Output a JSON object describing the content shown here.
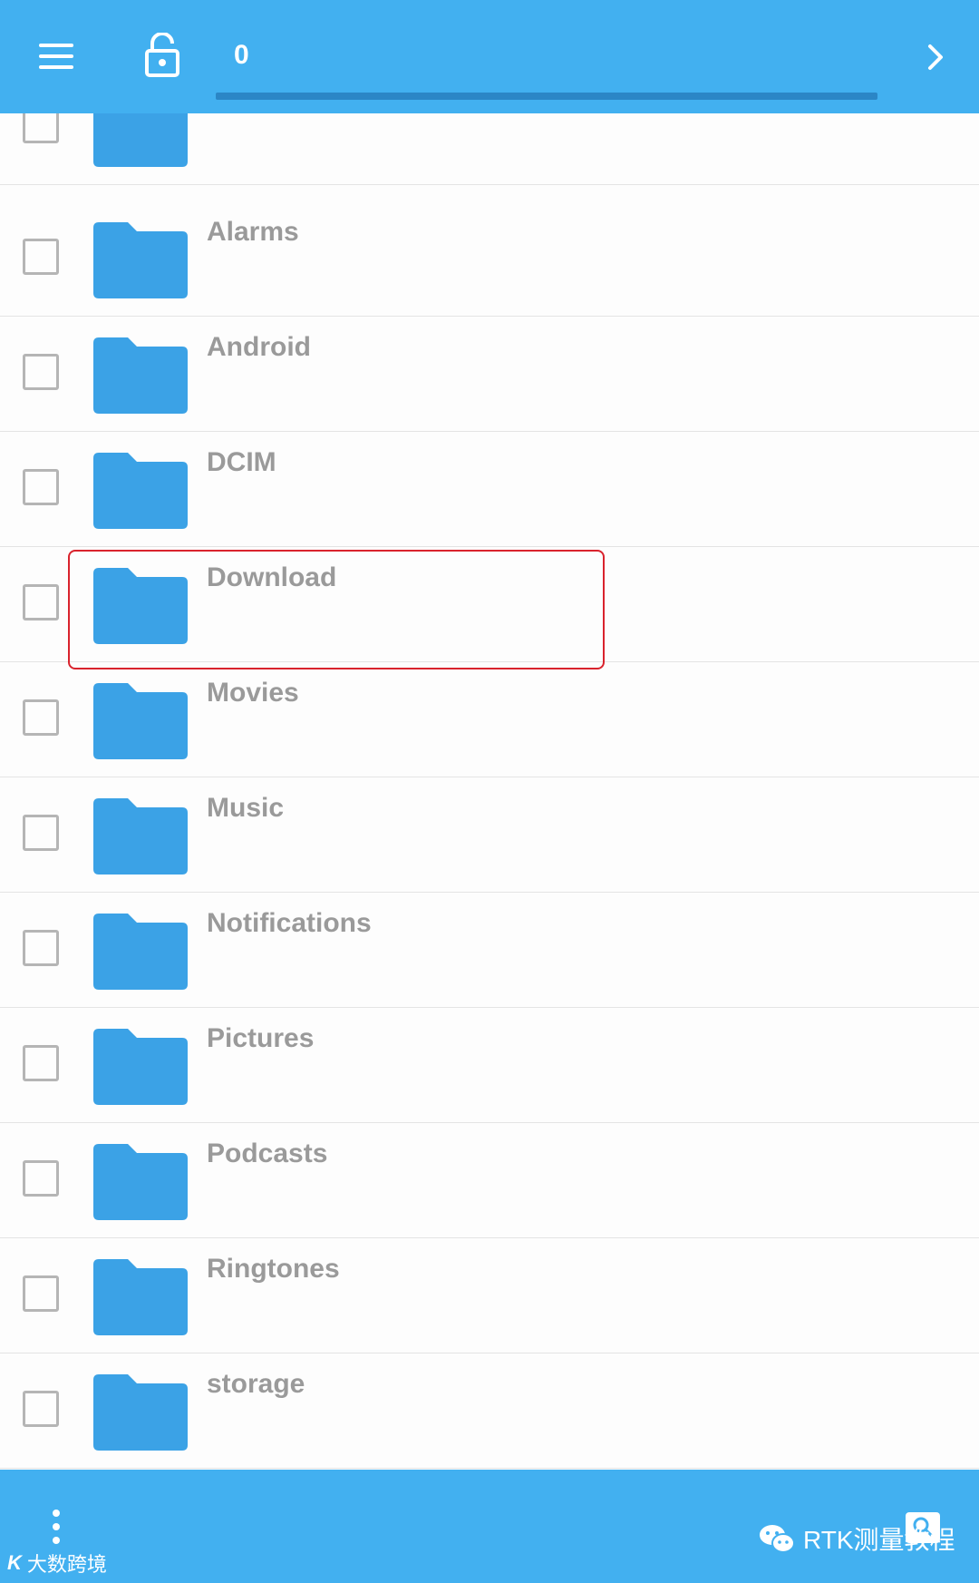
{
  "toolbar": {
    "path_value": "0",
    "colors": {
      "bar": "#42b0f0",
      "folder": "#3ba2e6",
      "highlight": "#d9232d"
    }
  },
  "folders": [
    {
      "name": ""
    },
    {
      "name": "Alarms"
    },
    {
      "name": "Android"
    },
    {
      "name": "DCIM"
    },
    {
      "name": "Download"
    },
    {
      "name": "Movies"
    },
    {
      "name": "Music"
    },
    {
      "name": "Notifications"
    },
    {
      "name": "Pictures"
    },
    {
      "name": "Podcasts"
    },
    {
      "name": "Ringtones"
    },
    {
      "name": "storage"
    }
  ],
  "watermarks": {
    "left_logo": "K",
    "left_text": "大数跨境",
    "right_text": "RTK测量教程"
  },
  "icons": [
    "menu-icon",
    "unlock-icon",
    "chevron-right-icon",
    "folder-icon",
    "checkbox-icon",
    "more-vert-icon",
    "search-icon",
    "wechat-icon"
  ]
}
